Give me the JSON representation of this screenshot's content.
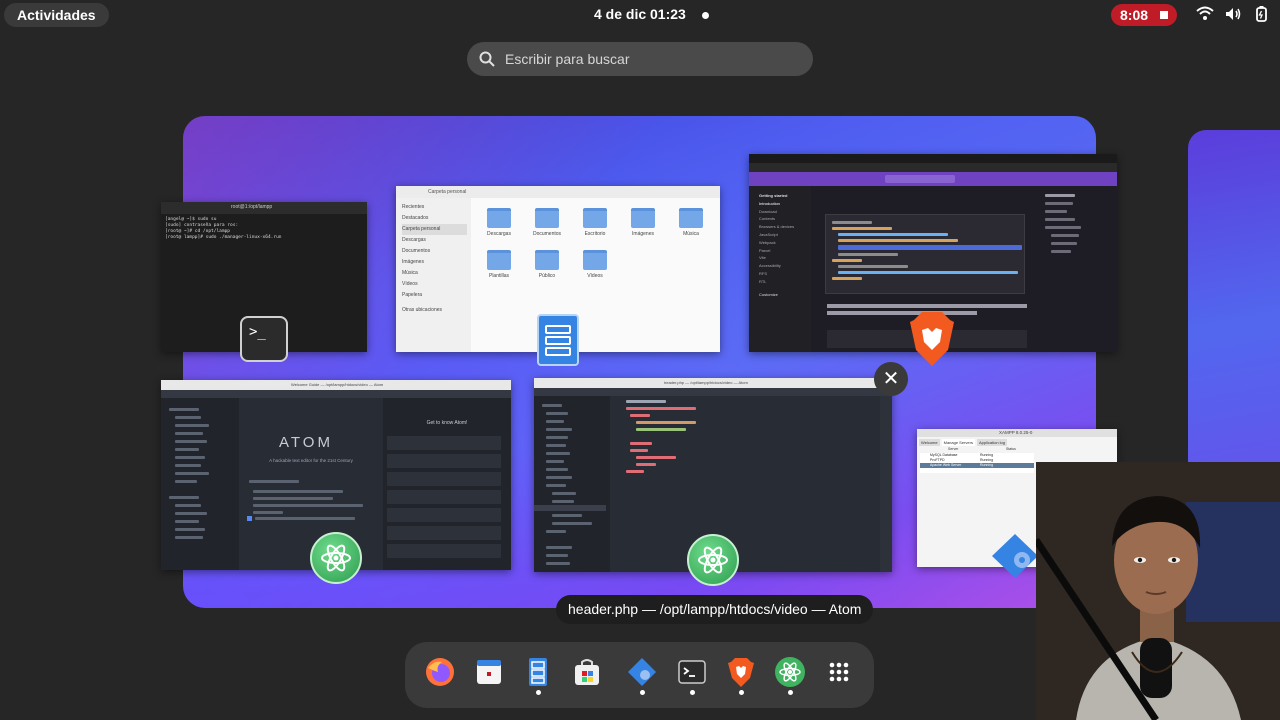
{
  "topbar": {
    "activities": "Actividades",
    "clock": "4 de dic  01:23",
    "recording": "8:08",
    "icons": [
      "wifi-icon",
      "volume-icon",
      "battery-icon"
    ]
  },
  "search": {
    "placeholder": "Escribir para buscar"
  },
  "windows": {
    "terminal": {
      "title": "root@1:/opt/lampp",
      "lines": [
        "[angel@ ~]$ sudo su",
        "[sudo] contraseña para ros:",
        "[root@ ~]# cd /opt/lampp",
        "[root@ lampp]# sudo ./manager-linux-x64.run"
      ]
    },
    "files": {
      "title": "Carpeta personal",
      "sidebar": [
        "Recientes",
        "Destacados",
        "Carpeta personal",
        "Descargas",
        "Documentos",
        "Imágenes",
        "Música",
        "Vídeos",
        "Papelera",
        "Otras ubicaciones"
      ],
      "folders": [
        "Descargas",
        "Documentos",
        "Escritorio",
        "Imágenes",
        "Música",
        "Plantillas",
        "Público",
        "Vídeos"
      ]
    },
    "browser": {
      "sidebar_heading": "Getting started",
      "sidebar_items": [
        "Introduction",
        "Download",
        "Contents",
        "Browsers & devices",
        "JavaScript",
        "Webpack",
        "Parcel",
        "Vite",
        "Accessibility",
        "RFS",
        "RTL",
        "Customize"
      ]
    },
    "atom1": {
      "title": "Welcome Guide — /opt/lampp/htdocs/video — Atom",
      "logo": "ATOM",
      "tagline": "A hackable text editor for the 21st Century",
      "guide_title": "Get to know Atom!"
    },
    "atom2": {
      "title": "header.php — /opt/lampp/htdocs/video — Atom"
    },
    "xampp": {
      "title": "XAMPP 8.0.25-0",
      "tabs": [
        "Welcome",
        "Manage Servers",
        "Application log"
      ],
      "headers": [
        "Server",
        "Status"
      ],
      "rows": [
        {
          "server": "MySQL Database",
          "status": "Running"
        },
        {
          "server": "ProFTPD",
          "status": "Running"
        },
        {
          "server": "Apache Web Server",
          "status": "Running"
        }
      ]
    }
  },
  "tooltip": "header.php — /opt/lampp/htdocs/video — Atom",
  "dock": {
    "items": [
      {
        "name": "firefox-icon",
        "running": false
      },
      {
        "name": "calendar-icon",
        "running": false
      },
      {
        "name": "files-icon",
        "running": true
      },
      {
        "name": "software-icon",
        "running": false
      },
      {
        "name": "xampp-icon",
        "running": true
      },
      {
        "name": "terminal-icon",
        "running": true
      },
      {
        "name": "brave-icon",
        "running": true
      },
      {
        "name": "atom-icon",
        "running": true
      },
      {
        "name": "app-grid-icon",
        "running": false
      }
    ]
  },
  "colors": {
    "record": "#c01c28",
    "atom": "#3fb35f",
    "brave": "#f25a20",
    "files": "#3584e4"
  }
}
